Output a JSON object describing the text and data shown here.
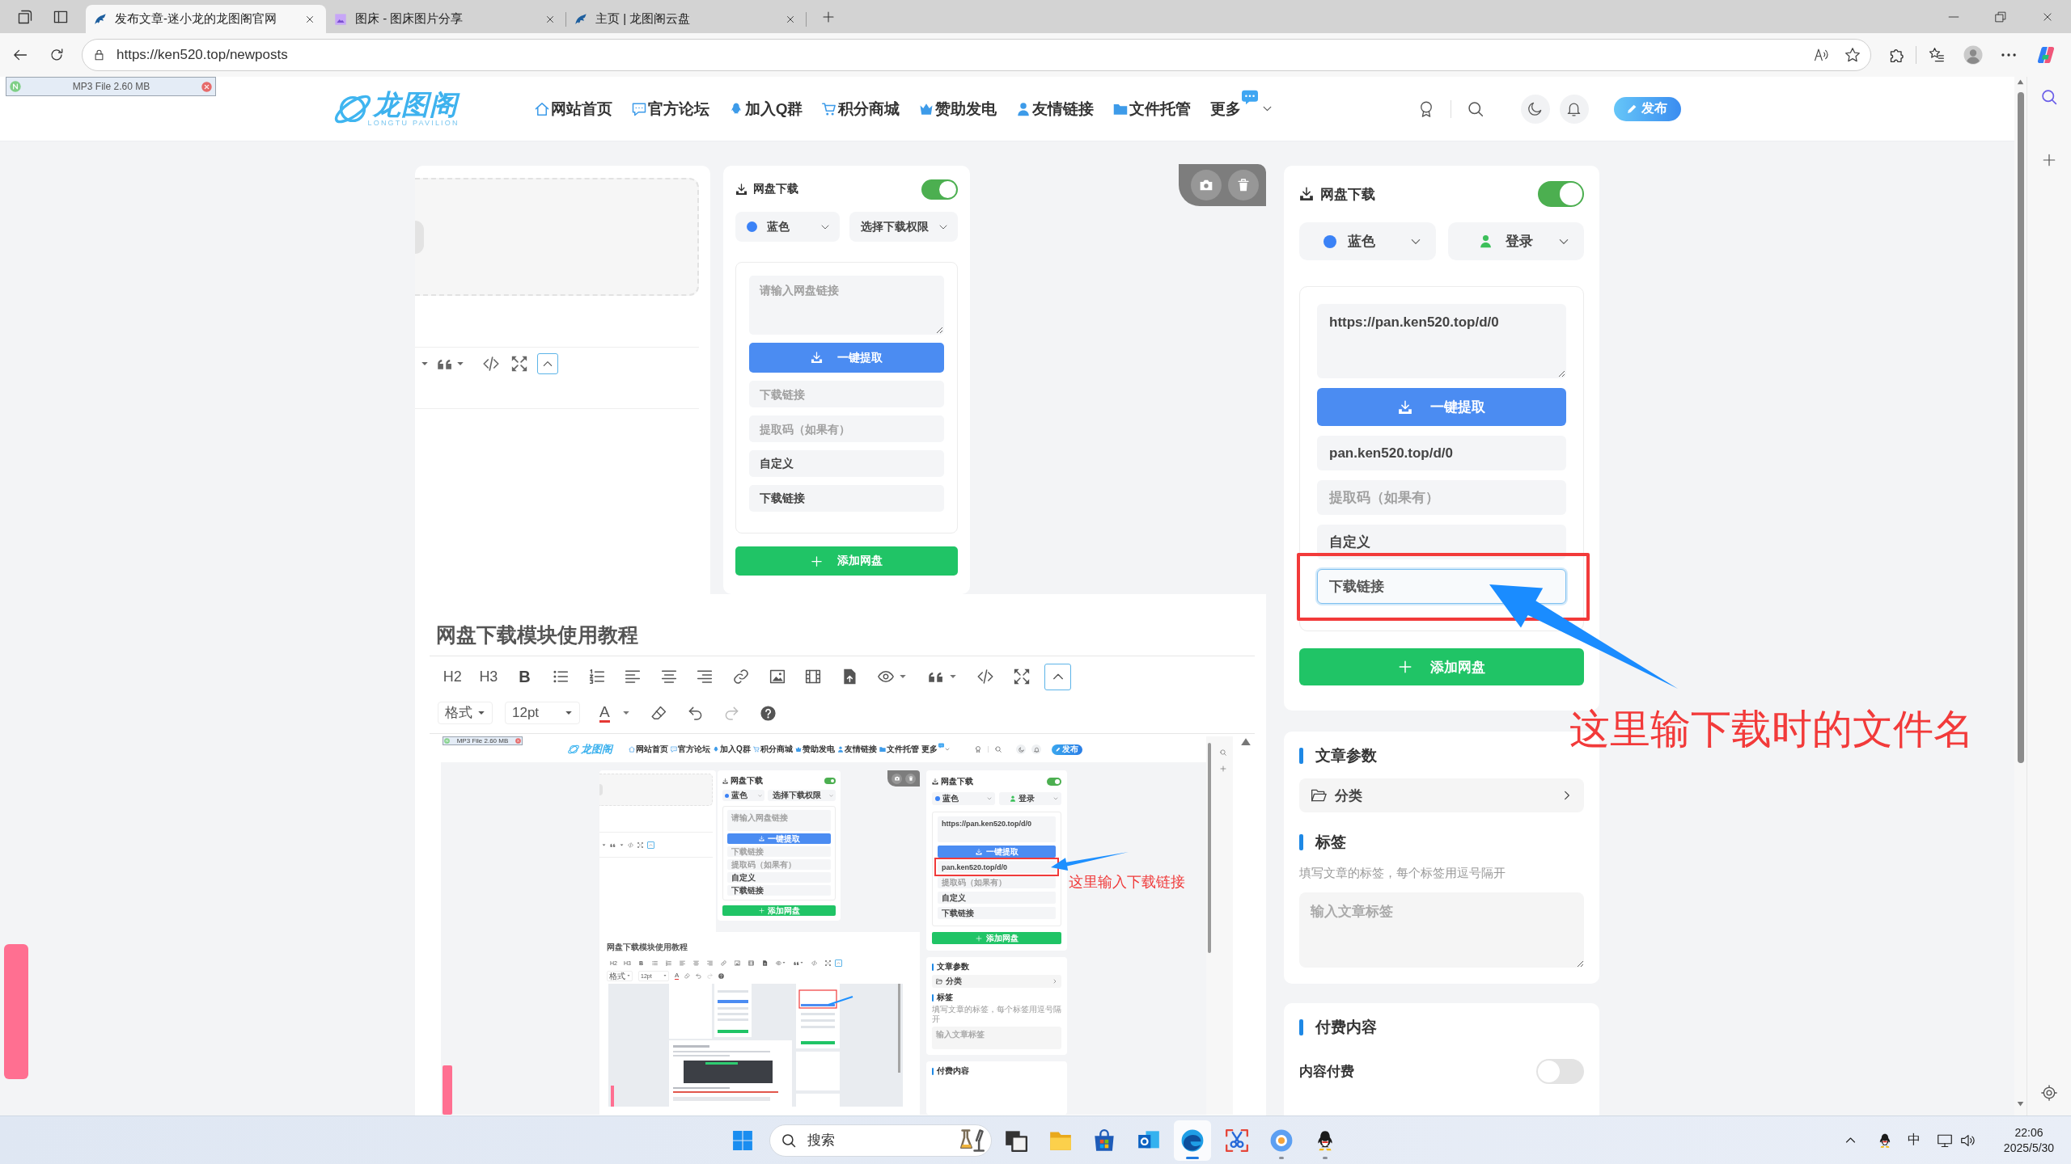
{
  "browser": {
    "tabs": [
      {
        "title": "发布文章-迷小龙的龙图阁官网",
        "selected": true
      },
      {
        "title": "图床 - 图床图片分享",
        "selected": false
      },
      {
        "title": "主页 | 龙图阁云盘",
        "selected": false
      }
    ],
    "address": "https://ken520.top/newposts"
  },
  "download_notice": {
    "label": "MP3 File 2.60 MB"
  },
  "header": {
    "logo": {
      "name": "龙图阁",
      "subtitle": "LONGTU PAVILION"
    },
    "nav": [
      {
        "label": "网站首页"
      },
      {
        "label": "官方论坛"
      },
      {
        "label": "加入Q群"
      },
      {
        "label": "积分商城"
      },
      {
        "label": "赞助发电"
      },
      {
        "label": "友情链接"
      },
      {
        "label": "文件托管"
      }
    ],
    "more": {
      "label": "更多",
      "badge": true
    },
    "publish_button": "发布"
  },
  "editor": {
    "upload_card": {
      "collapse_selected": true
    },
    "netdisk_popup": {
      "title": "网盘下载",
      "enabled": true,
      "color": {
        "label": "蓝色",
        "color": "#3b82f6"
      },
      "permission": {
        "label": "选择下载权限",
        "chosen": false
      },
      "link": {
        "placeholder": "请输入网盘链接"
      },
      "extract_button": "一键提取",
      "fields": [
        {
          "placeholder": "下载链接",
          "focused": false
        },
        {
          "placeholder": "提取码（如果有）",
          "focused": false
        },
        {
          "value": "自定义",
          "focused": false
        },
        {
          "value": "下载链接",
          "focused": false
        }
      ],
      "add_button": "添加网盘"
    },
    "title": "网盘下载模块使用教程",
    "toolbar": {
      "heading_buttons": [
        "H2",
        "H3"
      ],
      "bold_button": "B",
      "collapse_selected": true
    },
    "format_bar": {
      "format_select": "格式",
      "size_select": "12pt",
      "text_color_button": "A",
      "redo_disabled": true
    },
    "tutorial_screenshot": {
      "download_notice": "MP3 File 2.60 MB",
      "logo": "龙图阁",
      "nav": [
        "网站首页",
        "官方论坛",
        "加入Q群",
        "积分商城",
        "赞助发电",
        "友情链接",
        "文件托管"
      ],
      "more": {
        "label": "更多",
        "badge": true
      },
      "publish_button": "发布",
      "upload_card": {
        "collapse_selected": true
      },
      "popup": {
        "title": "网盘下载",
        "enabled": true,
        "color": {
          "label": "蓝色",
          "color": "#3b82f6"
        },
        "permission": {
          "label": "选择下载权限",
          "chosen": false
        },
        "link": {
          "placeholder": "请输入网盘链接"
        },
        "extract_button": "一键提取",
        "fields": [
          {
            "placeholder": "下载链接",
            "focused": false
          },
          {
            "placeholder": "提取码（如果有）",
            "focused": false
          },
          {
            "value": "自定义",
            "focused": false
          },
          {
            "value": "下载链接",
            "focused": false
          }
        ],
        "add_button": "添加网盘"
      },
      "panel": {
        "title": "网盘下载",
        "enabled": true,
        "color": {
          "label": "蓝色",
          "color": "#3b82f6"
        },
        "permission": {
          "label": "登录",
          "chosen": true
        },
        "link": {
          "value": "https://pan.ken520.top/d/0"
        },
        "extract_button": "一键提取",
        "fields": [
          {
            "value": "pan.ken520.top/d/0",
            "focused": false
          },
          {
            "placeholder": "提取码（如果有）",
            "focused": false
          },
          {
            "value": "自定义",
            "focused": false
          },
          {
            "value": "下载链接",
            "focused": false
          }
        ],
        "add_button": "添加网盘"
      },
      "note": "这里输入下载链接",
      "editor_title": "网盘下载模块使用教程",
      "toolbar": {
        "heading_buttons": [
          "H2",
          "H3"
        ],
        "bold_button": "B",
        "collapse_selected": true
      },
      "format_bar": {
        "format_select": "格式",
        "size_select": "12pt",
        "text_color_button": "A",
        "redo_disabled": true
      },
      "article_params": {
        "title": "文章参数",
        "category": "分类",
        "tags_title": "标签",
        "tags_hint": "填写文章的标签，每个标签用逗号隔开",
        "tags_placeholder": "输入文章标签"
      },
      "paid_content": {
        "title": "付费内容"
      }
    }
  },
  "sidebar": {
    "netdisk_card": {
      "title": "网盘下载",
      "enabled": true,
      "color": {
        "label": "蓝色",
        "color": "#3b82f6"
      },
      "permission": {
        "label": "登录",
        "chosen": true
      },
      "link": {
        "value": "https://pan.ken520.top/d/0"
      },
      "extract_button": "一键提取",
      "fields": [
        {
          "value": "pan.ken520.top/d/0",
          "focused": false
        },
        {
          "placeholder": "提取码（如果有）",
          "focused": false
        },
        {
          "value": "自定义",
          "focused": false
        },
        {
          "value": "下载链接",
          "focused": true
        }
      ],
      "add_button": "添加网盘"
    },
    "article_params": {
      "title": "文章参数",
      "category": "分类",
      "tags_title": "标签",
      "tags_hint": "填写文章的标签，每个标签用逗号隔开",
      "tags_placeholder": "输入文章标签"
    },
    "paid_content": {
      "title": "付费内容",
      "paid_label": "内容付费",
      "paid_enabled": false
    }
  },
  "annotation": {
    "note": "这里输下载时的文件名"
  },
  "taskbar": {
    "search_placeholder": "搜索",
    "apps": [
      {
        "selected": false,
        "running": false
      },
      {
        "selected": false,
        "running": false
      },
      {
        "selected": false,
        "running": false
      },
      {
        "selected": false,
        "running": false
      },
      {
        "selected": true,
        "running": true
      },
      {
        "selected": false,
        "running": false
      },
      {
        "selected": false,
        "running": true
      },
      {
        "selected": false,
        "running": true
      }
    ],
    "ime": "中",
    "time": "22:06",
    "date": "2025/5/30"
  }
}
